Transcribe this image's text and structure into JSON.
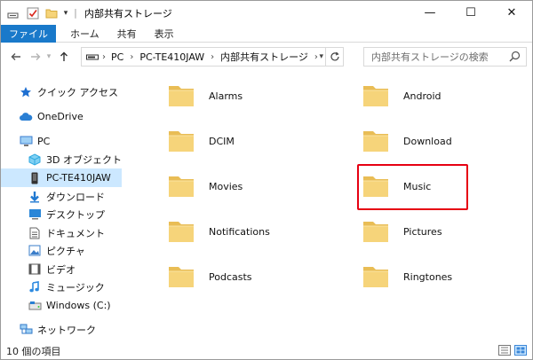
{
  "window": {
    "title": "内部共有ストレージ",
    "controls": {
      "minimize": "—",
      "maximize": "☐",
      "close": "✕"
    }
  },
  "ribbon": {
    "tabs": [
      {
        "label": "ファイル",
        "active": true
      },
      {
        "label": "ホーム"
      },
      {
        "label": "共有"
      },
      {
        "label": "表示"
      }
    ]
  },
  "address": {
    "crumbs": [
      "PC",
      "PC-TE410JAW",
      "内部共有ストレージ"
    ],
    "search_placeholder": "内部共有ストレージの検索"
  },
  "nav_pane": {
    "items": [
      {
        "label": "クイック アクセス",
        "icon": "star-icon",
        "color": "#1e6fd1"
      },
      {
        "label": "OneDrive",
        "icon": "cloud-icon",
        "color": "#2a7fd4"
      },
      {
        "label": "PC",
        "icon": "computer-icon",
        "color": "#3b7ed0"
      },
      {
        "label": "3D オブジェクト",
        "icon": "cube-icon",
        "color": "#2fa8e0"
      },
      {
        "label": "PC-TE410JAW",
        "icon": "phone-icon",
        "color": "#333333",
        "selected": true
      },
      {
        "label": "ダウンロード",
        "icon": "download-icon",
        "color": "#1f78d1"
      },
      {
        "label": "デスクトップ",
        "icon": "desktop-icon",
        "color": "#2a86d8"
      },
      {
        "label": "ドキュメント",
        "icon": "document-icon",
        "color": "#666666"
      },
      {
        "label": "ピクチャ",
        "icon": "pictures-icon",
        "color": "#3a7dc9"
      },
      {
        "label": "ビデオ",
        "icon": "video-icon",
        "color": "#555555"
      },
      {
        "label": "ミュージック",
        "icon": "music-icon",
        "color": "#2d8ae0"
      },
      {
        "label": "Windows (C:)",
        "icon": "drive-icon",
        "color": "#777777"
      },
      {
        "label": "ネットワーク",
        "icon": "network-icon",
        "color": "#3079c8"
      }
    ]
  },
  "folders": [
    {
      "name": "Alarms"
    },
    {
      "name": "Android"
    },
    {
      "name": "DCIM"
    },
    {
      "name": "Download"
    },
    {
      "name": "Movies"
    },
    {
      "name": "Music",
      "highlighted": true
    },
    {
      "name": "Notifications"
    },
    {
      "name": "Pictures"
    },
    {
      "name": "Podcasts"
    },
    {
      "name": "Ringtones"
    }
  ],
  "status": {
    "count_text": "10 個の項目"
  },
  "colors": {
    "accent": "#1979ca",
    "highlight": "#e60012",
    "folder": "#f6d47a",
    "selection": "#cce8ff"
  }
}
